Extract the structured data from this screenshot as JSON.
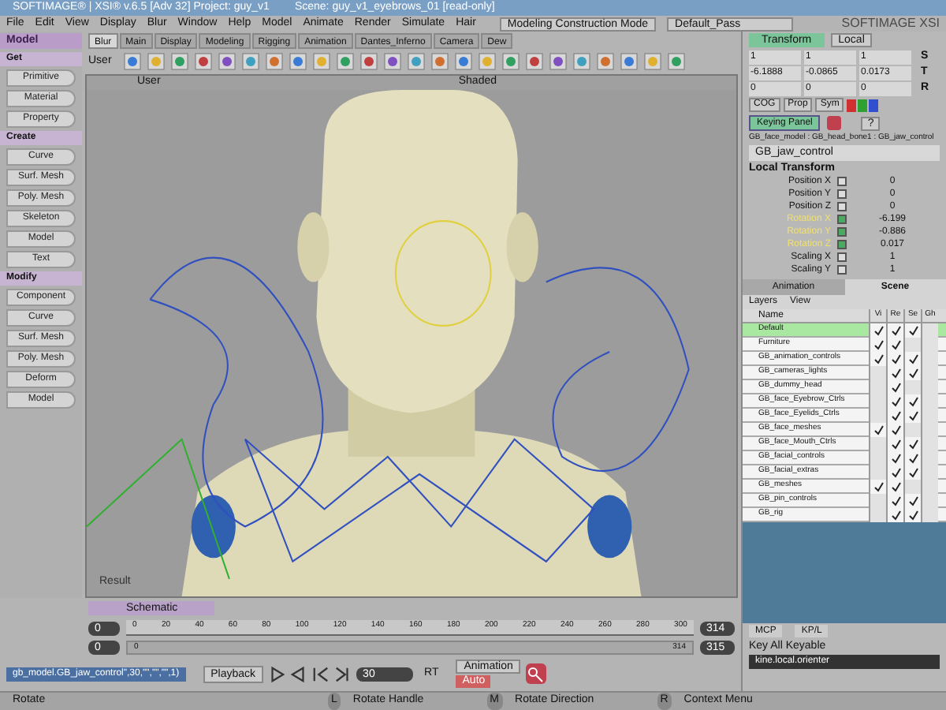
{
  "window": {
    "title": "SOFTIMAGE® | XSI® v.6.5 [Adv 32] Project: guy_v1",
    "scene": "Scene: guy_v1_eyebrows_01 [read-only]",
    "brand": "SOFTIMAGE XSI"
  },
  "menus": [
    "File",
    "Edit",
    "View",
    "Display",
    "Blur",
    "Window",
    "Help",
    "Model",
    "Animate",
    "Render",
    "Simulate",
    "Hair"
  ],
  "mode": "Modeling Construction Mode",
  "pass": "Default_Pass",
  "module": "Model",
  "sections": [
    {
      "title": "Get",
      "buttons": [
        "Primitive",
        "Material",
        "Property"
      ]
    },
    {
      "title": "Create",
      "buttons": [
        "Curve",
        "Surf. Mesh",
        "Poly. Mesh",
        "Skeleton",
        "Model",
        "Text"
      ]
    },
    {
      "title": "Modify",
      "buttons": [
        "Component",
        "Curve",
        "Surf. Mesh",
        "Poly. Mesh",
        "Deform",
        "Model"
      ]
    }
  ],
  "toolbar_tabs": [
    {
      "label": "Blur",
      "selected": true
    },
    {
      "label": "Main",
      "selected": false
    },
    {
      "label": "Display",
      "selected": false
    },
    {
      "label": "Modeling",
      "selected": false
    },
    {
      "label": "Rigging",
      "selected": false
    },
    {
      "label": "Animation",
      "selected": false
    },
    {
      "label": "Dantes_Inferno",
      "selected": false
    },
    {
      "label": "Camera",
      "selected": false
    },
    {
      "label": "Dew",
      "selected": false
    }
  ],
  "toolbar_label": "User",
  "viewport": {
    "camera": "User",
    "shading": "Shaded",
    "label": "Result"
  },
  "transform": {
    "tab": "Transform",
    "space": "Local",
    "rows": [
      {
        "key": "S",
        "values": [
          "1",
          "1",
          "1"
        ]
      },
      {
        "key": "T",
        "values": [
          "-6.1888",
          "-0.0865",
          "0.0173"
        ]
      },
      {
        "key": "R",
        "values": [
          "0",
          "0",
          "0"
        ]
      }
    ],
    "buttons": [
      "COG",
      "Prop",
      "Sym"
    ],
    "keying": "Keying Panel",
    "help": "?"
  },
  "path": "GB_face_model : GB_head_bone1 : GB_jaw_control",
  "object": "GB_jaw_control",
  "section": "Local Transform",
  "params": [
    {
      "name": "Position X",
      "value": "0",
      "animated": false
    },
    {
      "name": "Position Y",
      "value": "0",
      "animated": false
    },
    {
      "name": "Position Z",
      "value": "0",
      "animated": false
    },
    {
      "name": "Rotation X",
      "value": "-6.199",
      "animated": true
    },
    {
      "name": "Rotation Y",
      "value": "-0.886",
      "animated": true
    },
    {
      "name": "Rotation Z",
      "value": "0.017",
      "animated": true
    },
    {
      "name": "Scaling X",
      "value": "1",
      "animated": false
    },
    {
      "name": "Scaling Y",
      "value": "1",
      "animated": false
    }
  ],
  "explorer_tabs": [
    {
      "label": "Animation",
      "selected": false
    },
    {
      "label": "Scene",
      "selected": true
    }
  ],
  "explorer_menus": [
    "Layers",
    "View"
  ],
  "columns": [
    "Name",
    "Vi",
    "Re",
    "Se",
    "Gh"
  ],
  "layers": [
    {
      "name": "Default",
      "selected": true,
      "vi": true,
      "re": true,
      "se": true,
      "gh": false
    },
    {
      "name": "Furniture",
      "selected": false,
      "vi": true,
      "re": true,
      "se": false,
      "gh": false
    },
    {
      "name": "GB_animation_controls",
      "selected": false,
      "vi": true,
      "re": true,
      "se": true,
      "gh": false
    },
    {
      "name": "GB_cameras_lights",
      "selected": false,
      "vi": false,
      "re": true,
      "se": true,
      "gh": false
    },
    {
      "name": "GB_dummy_head",
      "selected": false,
      "vi": false,
      "re": true,
      "se": false,
      "gh": false
    },
    {
      "name": "GB_face_Eyebrow_Ctrls",
      "selected": false,
      "vi": false,
      "re": true,
      "se": true,
      "gh": false
    },
    {
      "name": "GB_face_Eyelids_Ctrls",
      "selected": false,
      "vi": false,
      "re": true,
      "se": true,
      "gh": false
    },
    {
      "name": "GB_face_meshes",
      "selected": false,
      "vi": true,
      "re": true,
      "se": false,
      "gh": false
    },
    {
      "name": "GB_face_Mouth_Ctrls",
      "selected": false,
      "vi": false,
      "re": true,
      "se": true,
      "gh": false
    },
    {
      "name": "GB_facial_controls",
      "selected": false,
      "vi": false,
      "re": true,
      "se": true,
      "gh": false
    },
    {
      "name": "GB_facial_extras",
      "selected": false,
      "vi": false,
      "re": true,
      "se": true,
      "gh": false
    },
    {
      "name": "GB_meshes",
      "selected": false,
      "vi": true,
      "re": true,
      "se": false,
      "gh": false
    },
    {
      "name": "GB_pin_controls",
      "selected": false,
      "vi": false,
      "re": true,
      "se": true,
      "gh": false
    },
    {
      "name": "GB_rig",
      "selected": false,
      "vi": false,
      "re": true,
      "se": true,
      "gh": false
    }
  ],
  "schematic": "Schematic",
  "timeline": {
    "start": "0",
    "range_start": "0",
    "ticks": [
      "0",
      "20",
      "40",
      "60",
      "80",
      "100",
      "120",
      "140",
      "160",
      "180",
      "200",
      "220",
      "240",
      "260",
      "280",
      "300"
    ],
    "range_zero": "0",
    "range_end": "314",
    "end": "314",
    "end2": "315",
    "frame": "30",
    "rt": "RT",
    "level": 1
  },
  "command": "gb_model.GB_jaw_control\",30,\"\",\"\",\"\",1)",
  "playback": "Playback",
  "animation": "Animation",
  "auto": "Auto",
  "mcp": [
    "MCP",
    "KP/L"
  ],
  "key_all": "Key All Keyable",
  "keyset": "kine.local.orienter",
  "status": [
    {
      "text": "Rotate"
    },
    {
      "key": "L",
      "text": "Rotate Handle"
    },
    {
      "key": "M",
      "text": "Rotate Direction"
    },
    {
      "key": "R",
      "text": "Context Menu"
    }
  ]
}
